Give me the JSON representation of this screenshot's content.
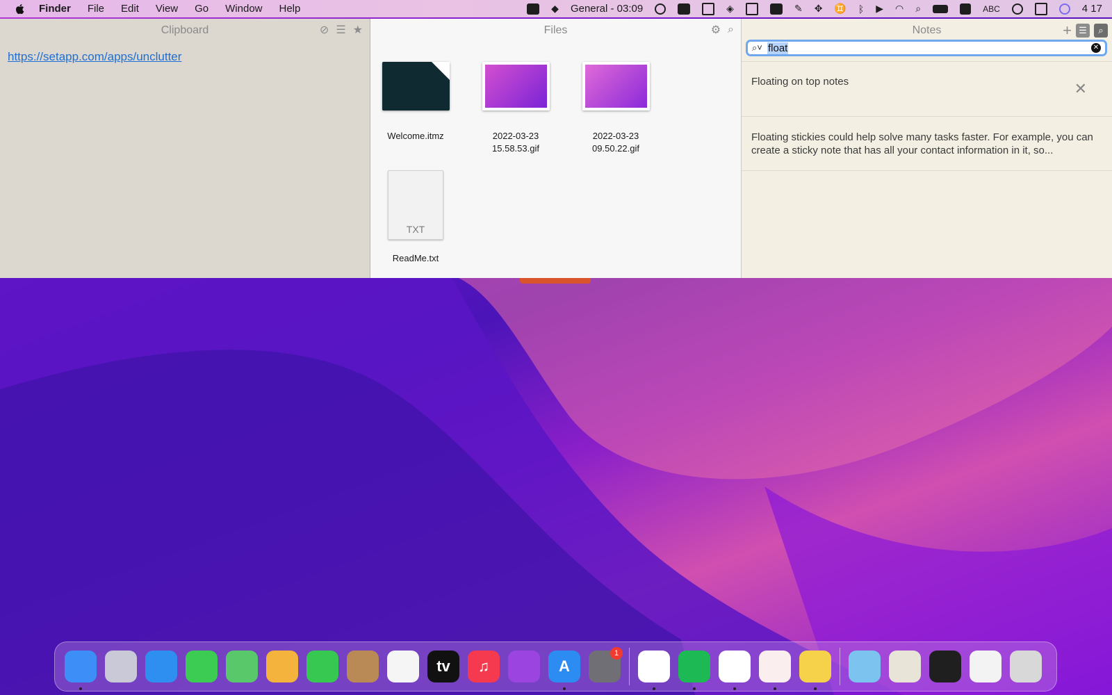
{
  "menubar": {
    "app_name": "Finder",
    "menus": [
      "File",
      "Edit",
      "View",
      "Go",
      "Window",
      "Help"
    ],
    "status_text": "General - 03:09",
    "input_source": "ABC",
    "clock": "4 17"
  },
  "clipboard": {
    "title": "Clipboard",
    "link": "https://setapp.com/apps/unclutter"
  },
  "files": {
    "title": "Files",
    "items": [
      {
        "name": "Welcome.itmz"
      },
      {
        "name": "2022-03-23 15.58.53.gif"
      },
      {
        "name": "2022-03-23 09.50.22.gif"
      },
      {
        "name": "ReadMe.txt",
        "type_label": "TXT"
      }
    ]
  },
  "notes": {
    "title": "Notes",
    "search_query": "float",
    "results": [
      {
        "text": "Floating on top notes"
      },
      {
        "text": "Floating stickies could help solve many tasks faster. For example, you can create a sticky note that has all your contact information in it, so..."
      }
    ]
  },
  "dock": {
    "apps": [
      {
        "icon": "finder-icon",
        "label": "",
        "color": "#3d8ef7",
        "running": true
      },
      {
        "icon": "launchpad-icon",
        "label": "",
        "color": "#c9c9d8",
        "running": false
      },
      {
        "icon": "safari-icon",
        "label": "",
        "color": "#2f8ff0",
        "running": false
      },
      {
        "icon": "messages-icon",
        "label": "",
        "color": "#3ccb53",
        "running": false
      },
      {
        "icon": "maps-icon",
        "label": "",
        "color": "#59c86a",
        "running": false
      },
      {
        "icon": "photos-icon",
        "label": "",
        "color": "#f3b33d",
        "running": false
      },
      {
        "icon": "facetime-icon",
        "label": "",
        "color": "#37c852",
        "running": false
      },
      {
        "icon": "contacts-icon",
        "label": "",
        "color": "#b98a56",
        "running": false
      },
      {
        "icon": "reminders-icon",
        "label": "",
        "color": "#f5f5f5",
        "running": false
      },
      {
        "icon": "appletv-icon",
        "label": "tv",
        "color": "#111111",
        "running": false
      },
      {
        "icon": "music-icon",
        "label": "♫",
        "color": "#f5394e",
        "running": false
      },
      {
        "icon": "podcasts-icon",
        "label": "",
        "color": "#9b44e0",
        "running": false
      },
      {
        "icon": "appstore-icon",
        "label": "A",
        "color": "#2d8cf2",
        "running": true
      },
      {
        "icon": "system-preferences-icon",
        "label": "",
        "color": "#6f6f75",
        "running": false,
        "badge": "1"
      }
    ],
    "apps2": [
      {
        "icon": "chrome-icon",
        "label": "",
        "color": "#ffffff",
        "running": true
      },
      {
        "icon": "spotify-icon",
        "label": "",
        "color": "#1db954",
        "running": true
      },
      {
        "icon": "slack-icon",
        "label": "",
        "color": "#ffffff",
        "running": true
      },
      {
        "icon": "timing-icon",
        "label": "",
        "color": "#fbeeee",
        "running": true
      },
      {
        "icon": "notes-app-icon",
        "label": "",
        "color": "#f6d24a",
        "running": true
      }
    ],
    "stack": [
      {
        "icon": "setapp-folder-icon",
        "color": "#7cc3f0"
      },
      {
        "icon": "downloads-stack-icon",
        "color": "#e9e4d8"
      },
      {
        "icon": "screenshot-stack-icon",
        "color": "#1f1f1f"
      },
      {
        "icon": "document-stack-icon",
        "color": "#f3f3f3"
      },
      {
        "icon": "trash-icon",
        "color": "#d8d8d8"
      }
    ]
  }
}
